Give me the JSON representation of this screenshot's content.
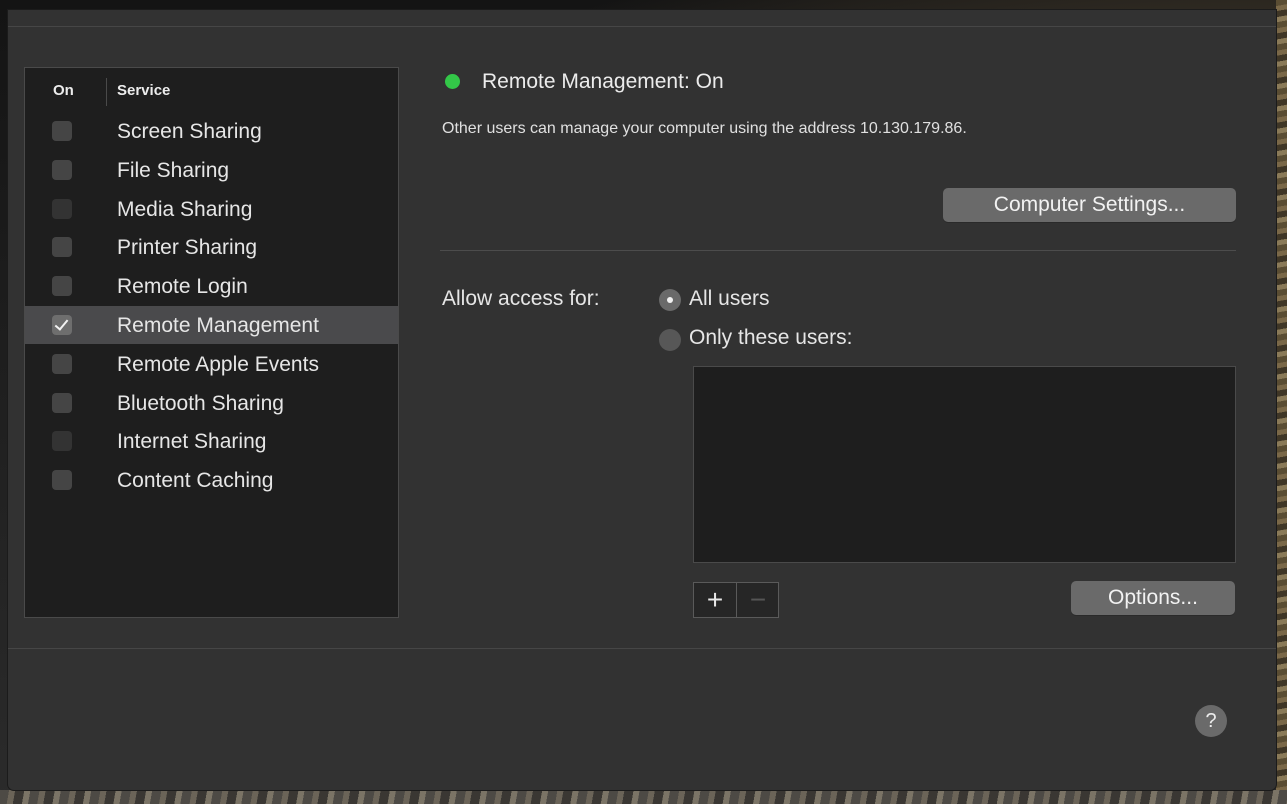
{
  "services": {
    "header_on": "On",
    "header_service": "Service",
    "items": [
      {
        "label": "Screen Sharing",
        "checked": false
      },
      {
        "label": "File Sharing",
        "checked": false
      },
      {
        "label": "Media Sharing",
        "checked": false
      },
      {
        "label": "Printer Sharing",
        "checked": false
      },
      {
        "label": "Remote Login",
        "checked": false
      },
      {
        "label": "Remote Management",
        "checked": true
      },
      {
        "label": "Remote Apple Events",
        "checked": false
      },
      {
        "label": "Bluetooth Sharing",
        "checked": false
      },
      {
        "label": "Internet Sharing",
        "checked": false
      },
      {
        "label": "Content Caching",
        "checked": false
      }
    ]
  },
  "status": {
    "title": "Remote Management: On",
    "description": "Other users can manage your computer using the address 10.130.179.86.",
    "indicator_color": "#33c748"
  },
  "buttons": {
    "computer_settings": "Computer Settings...",
    "options": "Options...",
    "add": "+",
    "remove": "−",
    "help": "?"
  },
  "access": {
    "label": "Allow access for:",
    "options": [
      "All users",
      "Only these users:"
    ],
    "selected": "All users"
  }
}
